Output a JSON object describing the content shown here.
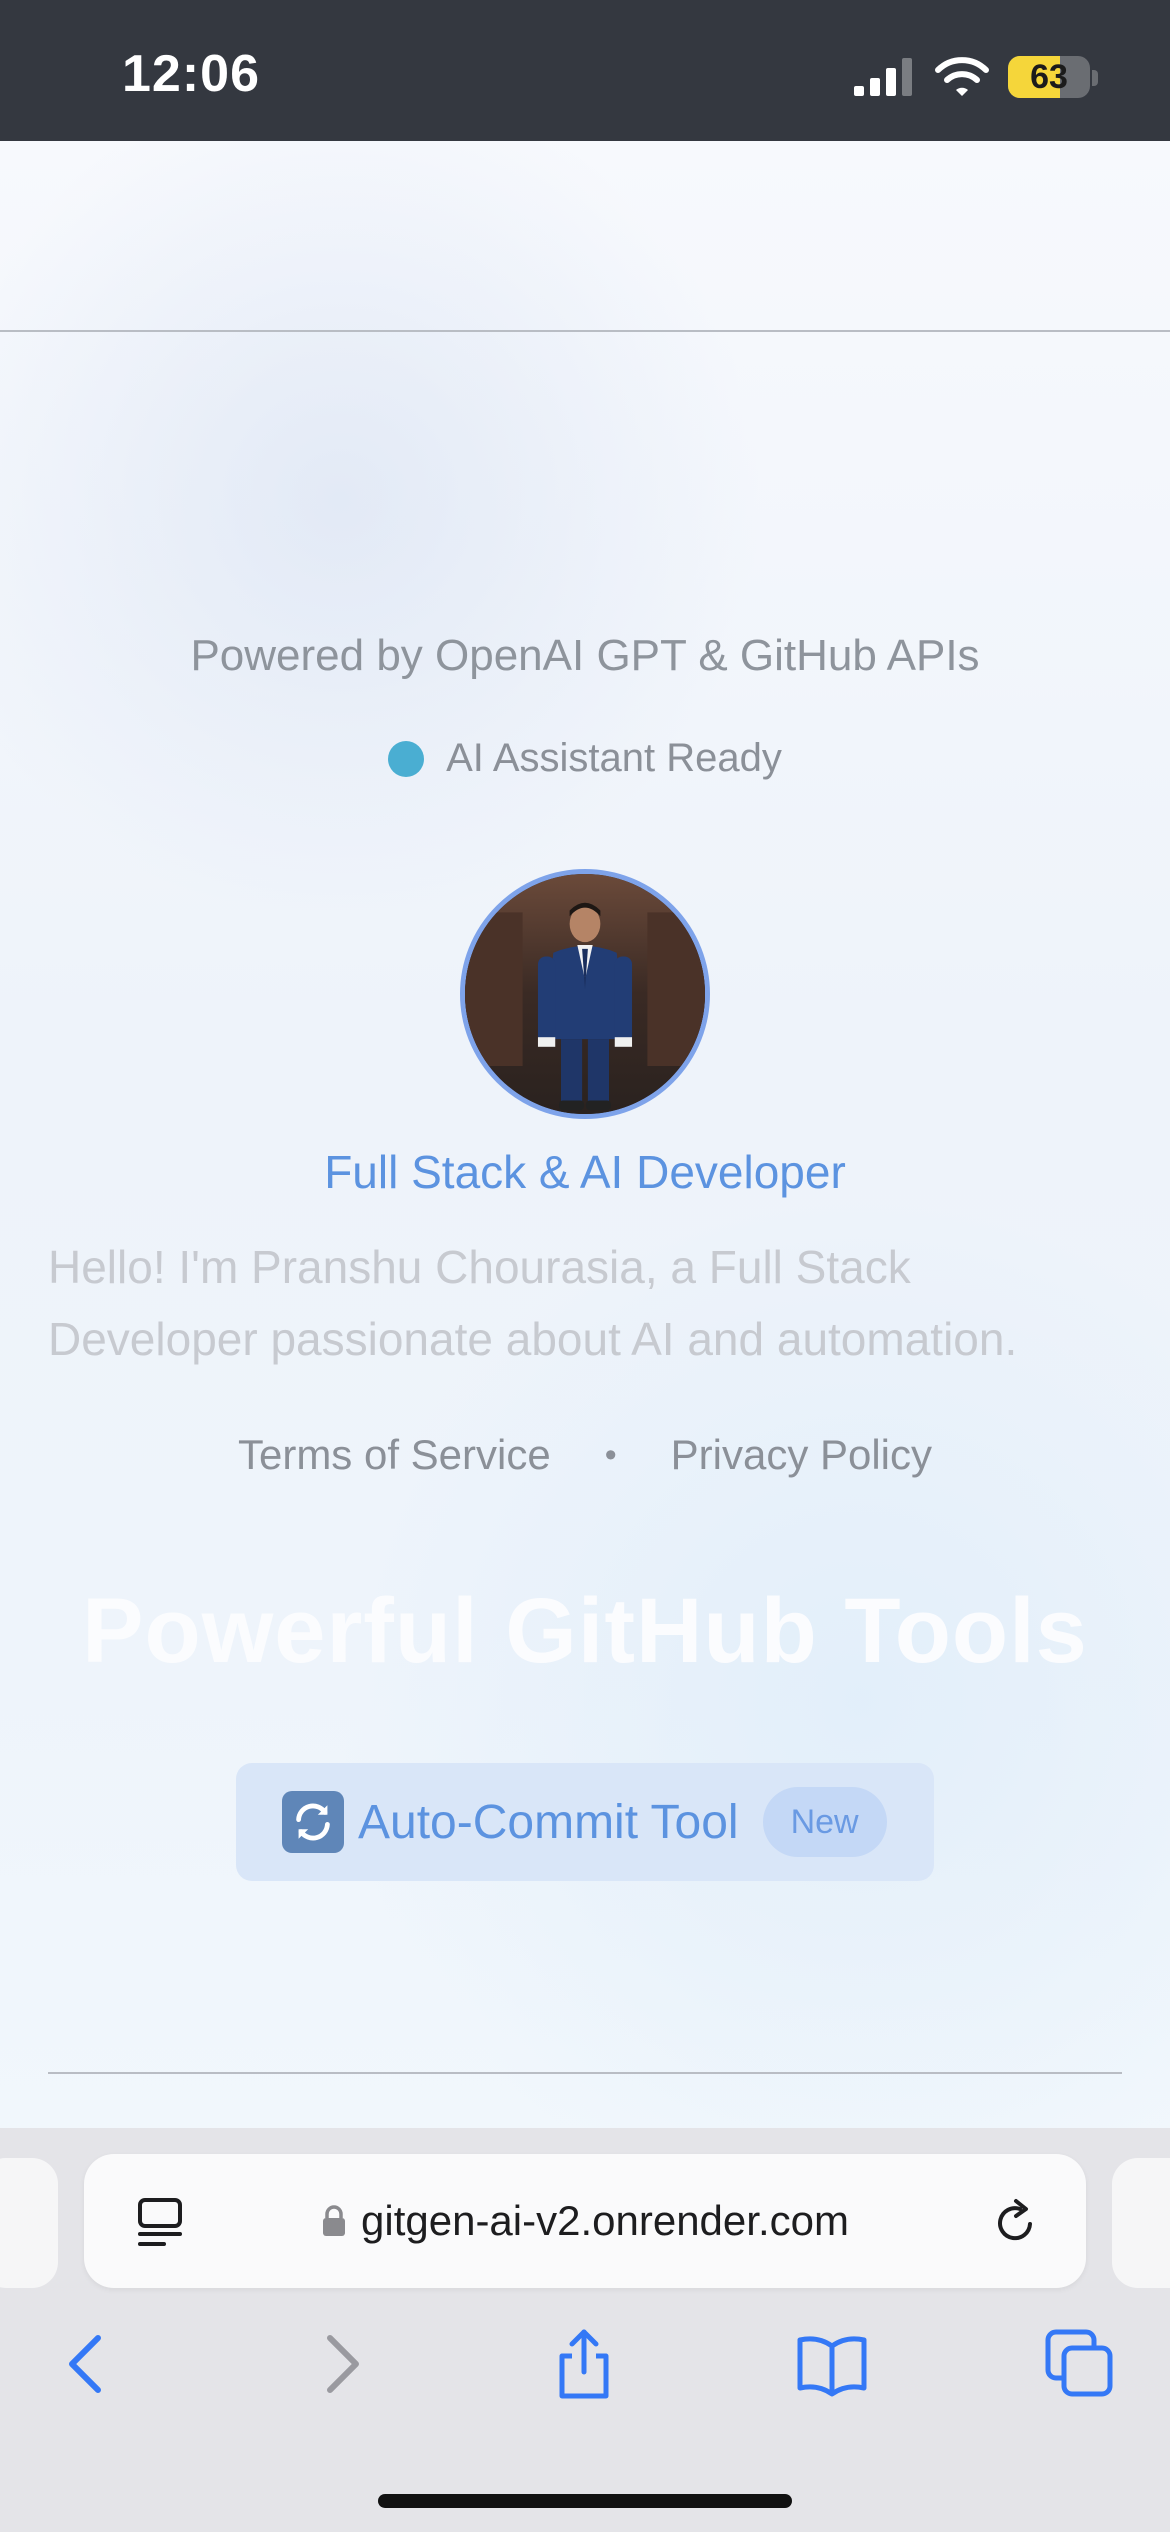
{
  "status_bar": {
    "time": "12:06",
    "battery_level": "63",
    "battery_percent": 63,
    "icons": [
      "signal-icon",
      "wifi-icon",
      "battery-icon"
    ]
  },
  "page": {
    "powered_by": "Powered by OpenAI GPT & GitHub APIs",
    "assistant_status": "AI Assistant Ready",
    "assistant_status_color": "#4aaed2",
    "role_title": "Full Stack & AI Developer",
    "bio": "Hello! I'm Pranshu Chourasia, a Full Stack Developer passionate about AI and automation.",
    "legal": {
      "terms": "Terms of Service",
      "separator": "•",
      "privacy": "Privacy Policy"
    },
    "section_heading": "Powerful GitHub Tools",
    "tool": {
      "icon": "refresh-icon",
      "label": "Auto-Commit Tool",
      "badge": "New"
    },
    "accent_color": "#5c93e0"
  },
  "browser": {
    "url": "gitgen-ai-v2.onrender.com",
    "toolbar": [
      "back-icon",
      "forward-icon",
      "share-icon",
      "bookmarks-icon",
      "tabs-icon"
    ]
  }
}
